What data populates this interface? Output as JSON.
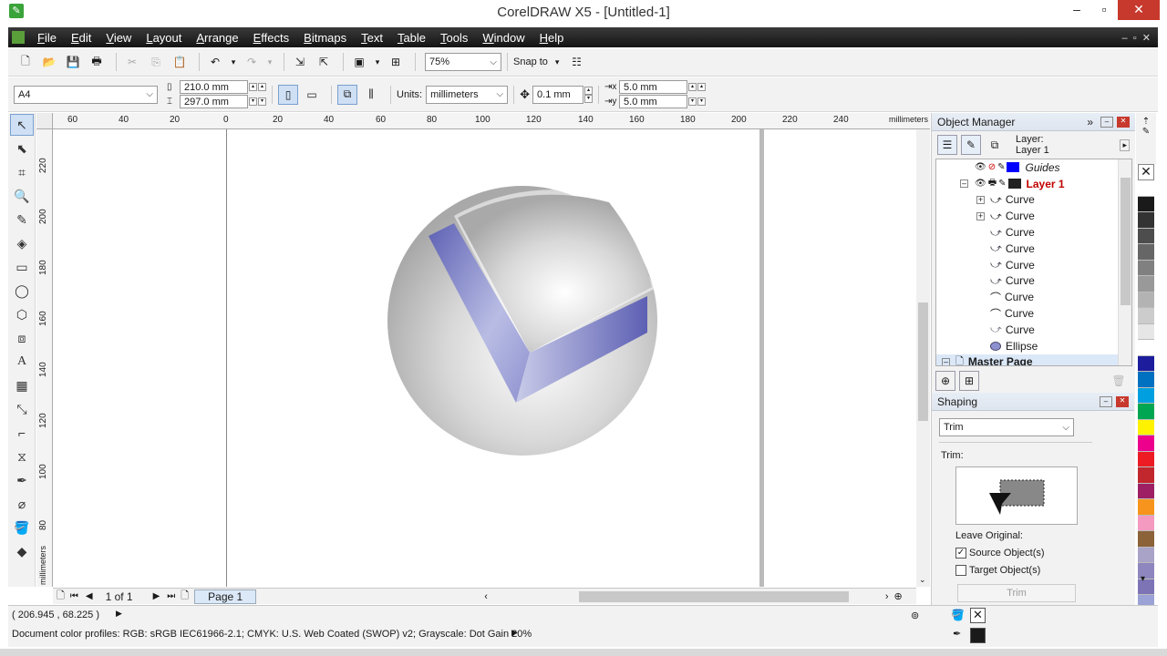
{
  "window": {
    "title": "CorelDRAW X5 - [Untitled-1]"
  },
  "menu": [
    "File",
    "Edit",
    "View",
    "Layout",
    "Arrange",
    "Effects",
    "Bitmaps",
    "Text",
    "Table",
    "Tools",
    "Window",
    "Help"
  ],
  "standard_toolbar": {
    "zoom": "75%",
    "snap_to": "Snap to"
  },
  "property_bar": {
    "page_size": "A4",
    "width": "210.0 mm",
    "height": "297.0 mm",
    "units_label": "Units:",
    "units": "millimeters",
    "nudge": "0.1 mm",
    "dup_x": "5.0 mm",
    "dup_y": "5.0 mm"
  },
  "rulers": {
    "h_ticks": [
      "60",
      "40",
      "20",
      "0",
      "20",
      "40",
      "60",
      "80",
      "100",
      "120",
      "140",
      "160",
      "180",
      "200",
      "220",
      "240"
    ],
    "h_unit": "millimeters",
    "v_ticks": [
      "220",
      "200",
      "180",
      "160",
      "140",
      "120",
      "100",
      "80"
    ],
    "v_unit": "millimeters"
  },
  "page_nav": {
    "count": "1 of 1",
    "tab": "Page 1"
  },
  "object_manager": {
    "title": "Object Manager",
    "layer_label": "Layer:",
    "layer_name": "Layer 1",
    "rows": [
      {
        "label": "Guides",
        "type": "guides"
      },
      {
        "label": "Layer 1",
        "type": "layer"
      },
      {
        "label": "Curve",
        "type": "group"
      },
      {
        "label": "Curve",
        "type": "group"
      },
      {
        "label": "Curve",
        "type": "curve"
      },
      {
        "label": "Curve",
        "type": "curve"
      },
      {
        "label": "Curve",
        "type": "curve"
      },
      {
        "label": "Curve",
        "type": "curve"
      },
      {
        "label": "Curve",
        "type": "curve"
      },
      {
        "label": "Curve",
        "type": "curve"
      },
      {
        "label": "Curve",
        "type": "curve"
      },
      {
        "label": "Ellipse",
        "type": "ellipse"
      },
      {
        "label": "Master Page",
        "type": "master"
      }
    ]
  },
  "shaping": {
    "title": "Shaping",
    "mode": "Trim",
    "section_label": "Trim:",
    "leave_original": "Leave Original:",
    "source_label": "Source Object(s)",
    "source_checked": true,
    "target_label": "Target Object(s)",
    "target_checked": false,
    "apply_button": "Trim"
  },
  "palette": [
    "#ffffff",
    "#1a1a1a",
    "#333333",
    "#4d4d4d",
    "#666666",
    "#808080",
    "#999999",
    "#b3b3b3",
    "#cccccc",
    "#e6e6e6",
    "#ffffff",
    "#1c1c9c",
    "#0070c0",
    "#00a0e0",
    "#00a651",
    "#fff200",
    "#ec008c",
    "#ed1c24",
    "#c1272d",
    "#9e1f63",
    "#f7941d",
    "#f49ac1",
    "#8c6239",
    "#a9a3c8",
    "#8e86be",
    "#7d74b6",
    "#9aa2d6",
    "#6a5fad"
  ],
  "status": {
    "coords": "( 206.945 , 68.225 )",
    "profiles": "Document color profiles: RGB: sRGB IEC61966-2.1; CMYK: U.S. Web Coated (SWOP) v2; Grayscale: Dot Gain 20%"
  }
}
